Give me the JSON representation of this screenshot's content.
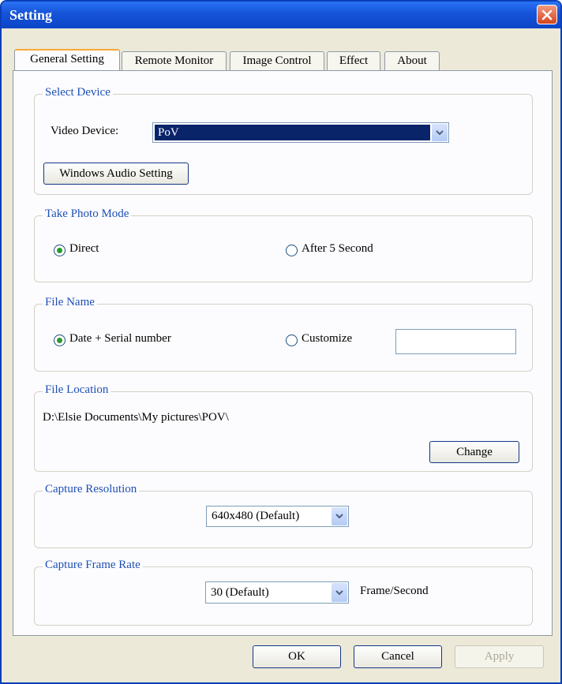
{
  "window": {
    "title": "Setting",
    "close_icon": "close-icon"
  },
  "tabs": [
    {
      "label": "General Setting",
      "active": true
    },
    {
      "label": "Remote Monitor",
      "active": false
    },
    {
      "label": "Image Control",
      "active": false
    },
    {
      "label": "Effect",
      "active": false
    },
    {
      "label": "About",
      "active": false
    }
  ],
  "select_device": {
    "legend": "Select Device",
    "video_device_label": "Video Device:",
    "video_device_value": "PoV",
    "audio_button": "Windows Audio Setting"
  },
  "take_photo_mode": {
    "legend": "Take Photo Mode",
    "options": [
      {
        "label": "Direct",
        "checked": true
      },
      {
        "label": "After 5 Second",
        "checked": false
      }
    ]
  },
  "file_name": {
    "legend": "File Name",
    "options": [
      {
        "label": "Date +  Serial number",
        "checked": true
      },
      {
        "label": "Customize",
        "checked": false
      }
    ],
    "customize_value": ""
  },
  "file_location": {
    "legend": "File Location",
    "path": "D:\\Elsie Documents\\My pictures\\POV\\",
    "change_button": "Change"
  },
  "capture_resolution": {
    "legend": "Capture Resolution",
    "value": "640x480 (Default)"
  },
  "capture_frame_rate": {
    "legend": "Capture Frame Rate",
    "value": "30 (Default)",
    "unit": "Frame/Second"
  },
  "footer": {
    "ok": "OK",
    "cancel": "Cancel",
    "apply": "Apply",
    "apply_enabled": false
  },
  "colors": {
    "titlebar": "#1553d8",
    "legend_text": "#1d4fb5",
    "selection": "#0a246a",
    "face": "#ece9d8"
  }
}
